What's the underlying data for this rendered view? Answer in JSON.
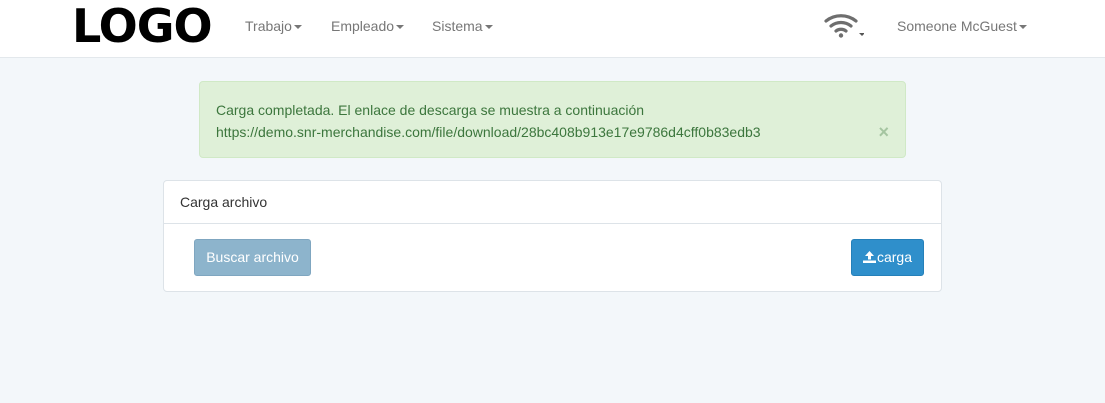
{
  "navbar": {
    "logo": "LOGO",
    "menu": [
      {
        "label": "Trabajo"
      },
      {
        "label": "Empleado"
      },
      {
        "label": "Sistema"
      }
    ],
    "wifi_icon": "wifi-icon",
    "user": "Someone McGuest"
  },
  "alert": {
    "message": "Carga completada. El enlace de descarga se muestra a continuación",
    "link": "https://demo.snr-merchandise.com/file/download/28bc408b913e17e9786d4cff0b83edb3",
    "close": "×",
    "color": "#3c763d",
    "background": "#dff0d8"
  },
  "panel": {
    "title": "Carga archivo",
    "browse_label": "Buscar archivo",
    "upload_label": "carga",
    "upload_icon": "upload-icon"
  }
}
